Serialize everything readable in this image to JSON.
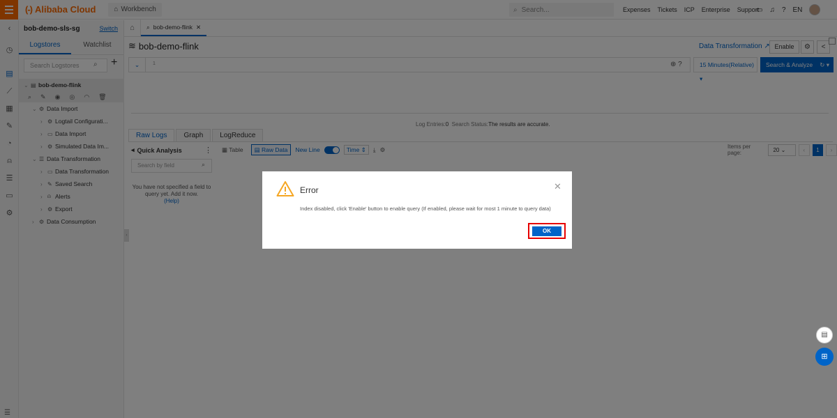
{
  "topbar": {
    "brand": "Alibaba Cloud",
    "brand_mark": "(-)",
    "workbench": "Workbench",
    "search_placeholder": "Search...",
    "links": [
      "Expenses",
      "Tickets",
      "ICP",
      "Enterprise",
      "Support"
    ],
    "lang": "EN"
  },
  "sidebar": {
    "project": "bob-demo-sls-sg",
    "switch": "Switch",
    "tabs": [
      "Logstores",
      "Watchlist"
    ],
    "search_placeholder": "Search Logstores",
    "logstore": "bob-demo-flink",
    "tree": [
      {
        "label": "Data Import"
      },
      {
        "label": "Logtail Configurati..."
      },
      {
        "label": "Data Import"
      },
      {
        "label": "Simulated Data Im..."
      },
      {
        "label": "Data Transformation"
      },
      {
        "label": "Data Transformation"
      },
      {
        "label": "Saved Search"
      },
      {
        "label": "Alerts"
      },
      {
        "label": "Export"
      },
      {
        "label": "Data Consumption"
      }
    ]
  },
  "main": {
    "tab_label": "bob-demo-flink",
    "title": "bob-demo-flink",
    "data_transformation": "Data Transformation",
    "enable": "Enable",
    "query_line": "1",
    "time_range": "15 Minutes(Relative)",
    "search_analyze": "Search & Analyze",
    "status_label1": "Log Entries:",
    "status_val1": "0",
    "status_label2": "Search Status:",
    "status_val2": "The results are accurate.",
    "result_tabs": [
      "Raw Logs",
      "Graph",
      "LogReduce"
    ],
    "quick_analysis": "Quick Analysis",
    "field_search_placeholder": "Search by field",
    "no_field_msg": "You have not specified a field to query yet. Add it now.",
    "help": "(Help)",
    "view_table": "Table",
    "view_raw": "Raw Data",
    "new_line": "New Line",
    "time": "Time",
    "items_per_page": "Items per page:",
    "page_size": "20",
    "page": "1"
  },
  "dialog": {
    "title": "Error",
    "message": "Index disabled, click 'Enable' button to enable query (If enabled, please wait for most 1 minute to query data)",
    "ok": "OK"
  }
}
